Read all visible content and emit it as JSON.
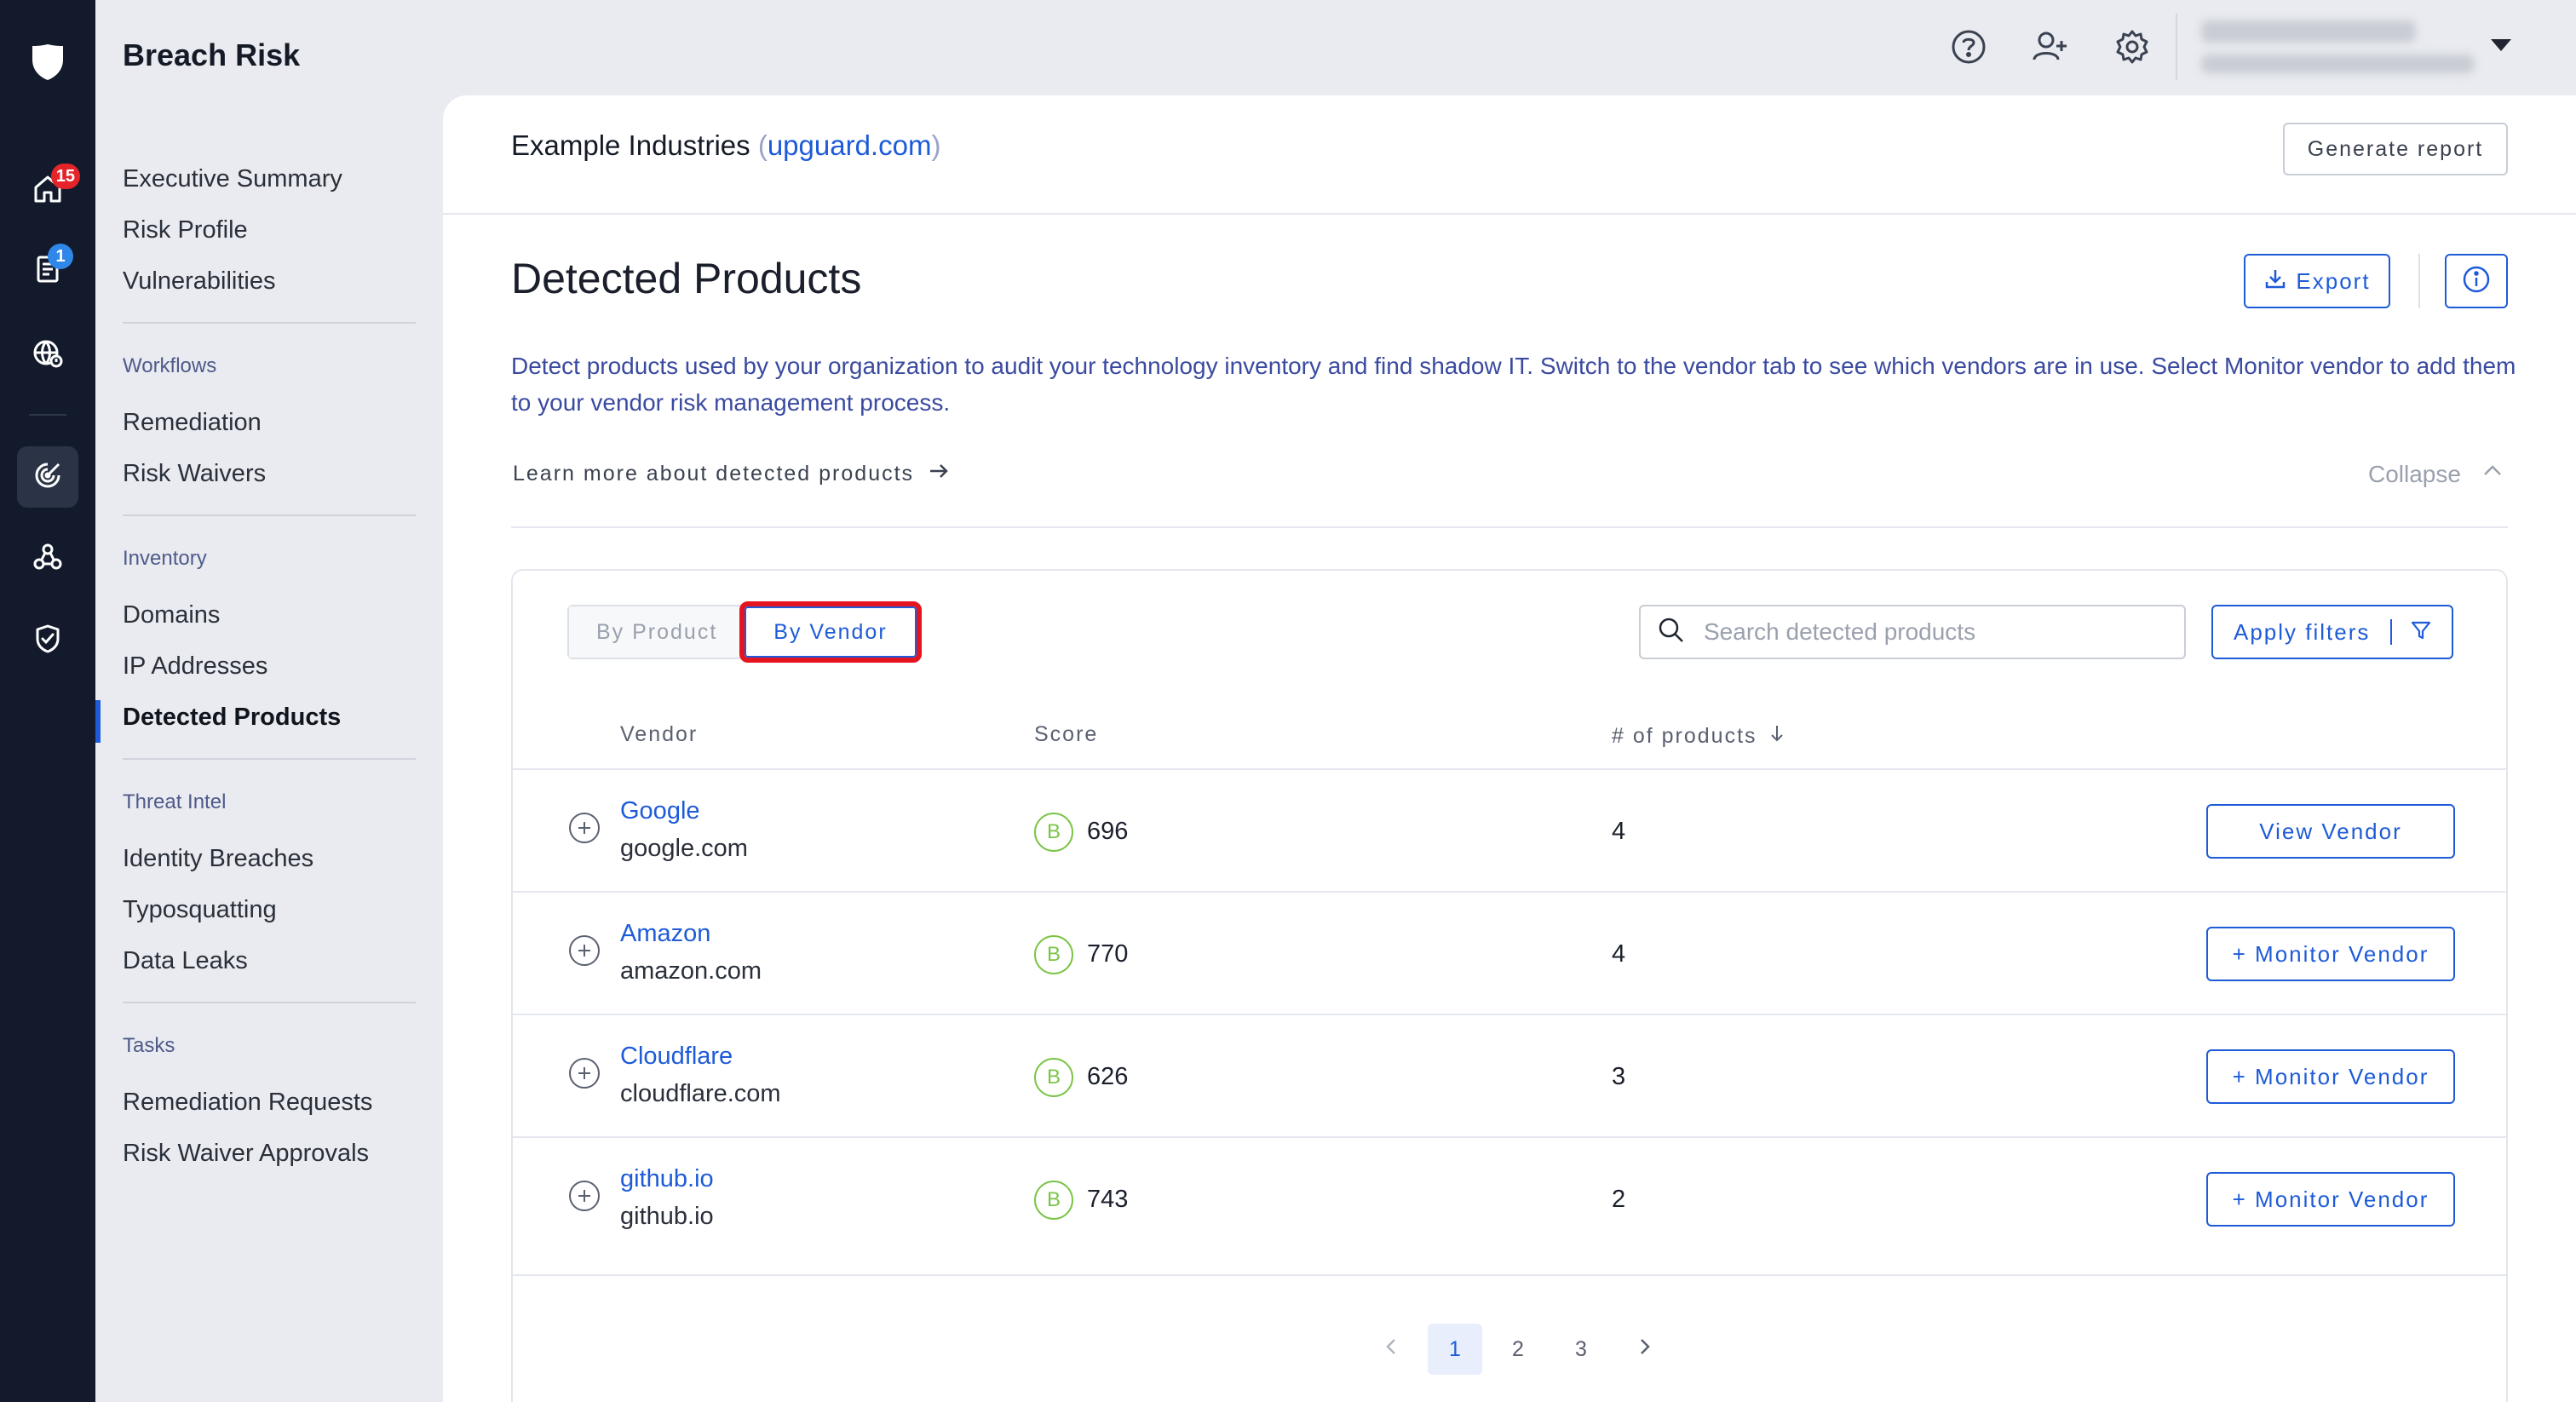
{
  "app": {
    "title": "Breach Risk",
    "badges": {
      "home": "15",
      "reports": "1"
    }
  },
  "icons": {
    "rail": [
      "shield-logo-icon",
      "home-icon",
      "report-icon",
      "globe-alert-icon",
      "breach-risk-icon",
      "vendors-icon",
      "trust-shield-icon"
    ],
    "header": [
      "help-icon",
      "add-user-icon",
      "settings-icon"
    ]
  },
  "subnav": {
    "top_items": [
      {
        "label": "Executive Summary"
      },
      {
        "label": "Risk Profile"
      },
      {
        "label": "Vulnerabilities"
      }
    ],
    "sections": [
      {
        "title": "Workflows",
        "items": [
          {
            "label": "Remediation"
          },
          {
            "label": "Risk Waivers"
          }
        ]
      },
      {
        "title": "Inventory",
        "items": [
          {
            "label": "Domains"
          },
          {
            "label": "IP Addresses"
          },
          {
            "label": "Detected Products"
          }
        ]
      },
      {
        "title": "Threat Intel",
        "items": [
          {
            "label": "Identity Breaches"
          },
          {
            "label": "Typosquatting"
          },
          {
            "label": "Data Leaks"
          }
        ]
      },
      {
        "title": "Tasks",
        "items": [
          {
            "label": "Remediation Requests"
          },
          {
            "label": "Risk Waiver Approvals"
          }
        ]
      }
    ],
    "active_item": "Detected Products"
  },
  "header": {
    "company_name": "Example Industries",
    "company_domain": "upguard.com",
    "paren_open": "(",
    "paren_close": ")",
    "generate_report_label": "Generate report"
  },
  "page": {
    "title": "Detected Products",
    "export_label": "Export",
    "description": "Detect products used by your organization to audit your technology inventory and find shadow IT. Switch to the vendor tab to see which vendors are in use. Select Monitor vendor to add them to your vendor risk management process.",
    "learn_more_label": "Learn more about detected products",
    "collapse_label": "Collapse"
  },
  "toolbar": {
    "tabs": [
      {
        "label": "By Product"
      },
      {
        "label": "By Vendor"
      }
    ],
    "active_tab": "By Vendor",
    "search_placeholder": "Search detected products",
    "search_value": "",
    "apply_filters_label": "Apply filters"
  },
  "table": {
    "columns": [
      {
        "label": "Vendor"
      },
      {
        "label": "Score"
      },
      {
        "label": "# of products"
      }
    ],
    "sort_column": "# of products",
    "sort_direction": "descending",
    "rows": [
      {
        "vendor": "Google",
        "domain": "google.com",
        "grade": "B",
        "score": "696",
        "products": "4",
        "action": "View Vendor"
      },
      {
        "vendor": "Amazon",
        "domain": "amazon.com",
        "grade": "B",
        "score": "770",
        "products": "4",
        "action": "+ Monitor Vendor"
      },
      {
        "vendor": "Cloudflare",
        "domain": "cloudflare.com",
        "grade": "B",
        "score": "626",
        "products": "3",
        "action": "+ Monitor Vendor"
      },
      {
        "vendor": "github.io",
        "domain": "github.io",
        "grade": "B",
        "score": "743",
        "products": "2",
        "action": "+ Monitor Vendor"
      }
    ]
  },
  "pagination": {
    "pages": [
      "1",
      "2",
      "3"
    ],
    "current": "1"
  },
  "colors": {
    "accent": "#1e5bd8",
    "grade_b": "#7bc446",
    "highlight": "#e5151f",
    "badge_red": "#e5242a",
    "badge_blue": "#2f87e8"
  }
}
